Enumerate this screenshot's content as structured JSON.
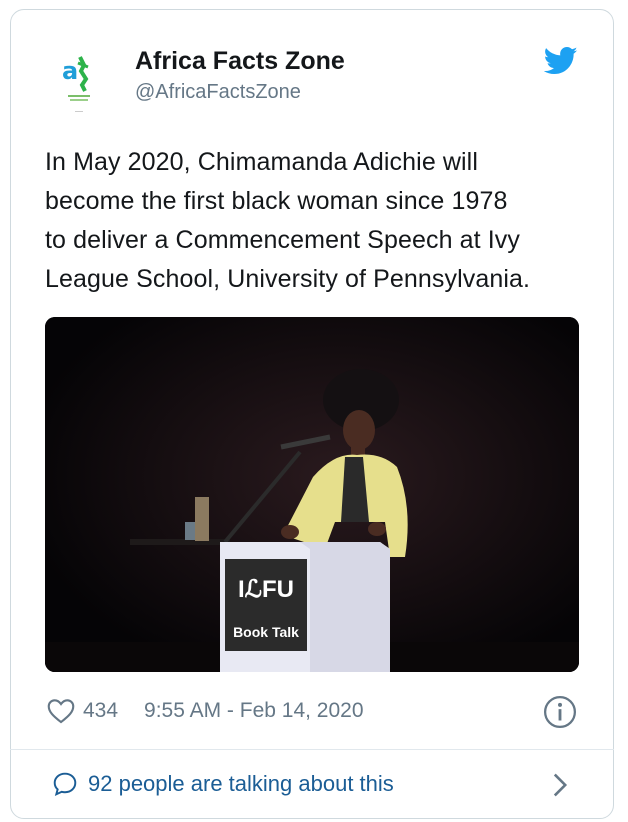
{
  "author": {
    "name": "Africa Facts Zone",
    "handle": "@AfricaFactsZone",
    "avatar_icon": "africa-facts-zone-logo"
  },
  "tweet": {
    "lines": [
      "In May 2020, Chimamanda Adichie will",
      "become the first black woman since 1978",
      "to deliver a Commencement Speech at Ivy",
      "League School, University of Pennsylvania."
    ]
  },
  "media": {
    "podium_logo": "IℒFU",
    "podium_label": "Book Talk"
  },
  "meta": {
    "likes": "434",
    "timestamp": "9:55 AM - Feb 14, 2020"
  },
  "footer": {
    "talking": "92 people are talking about this"
  },
  "colors": {
    "twitter_blue": "#1da1f2",
    "link_blue": "#1b5d95",
    "muted": "#657786",
    "jacket_yellow": "#e6df8c"
  },
  "icons": [
    "twitter-bird-icon",
    "heart-icon",
    "info-icon",
    "speech-bubble-icon",
    "chevron-right-icon"
  ]
}
